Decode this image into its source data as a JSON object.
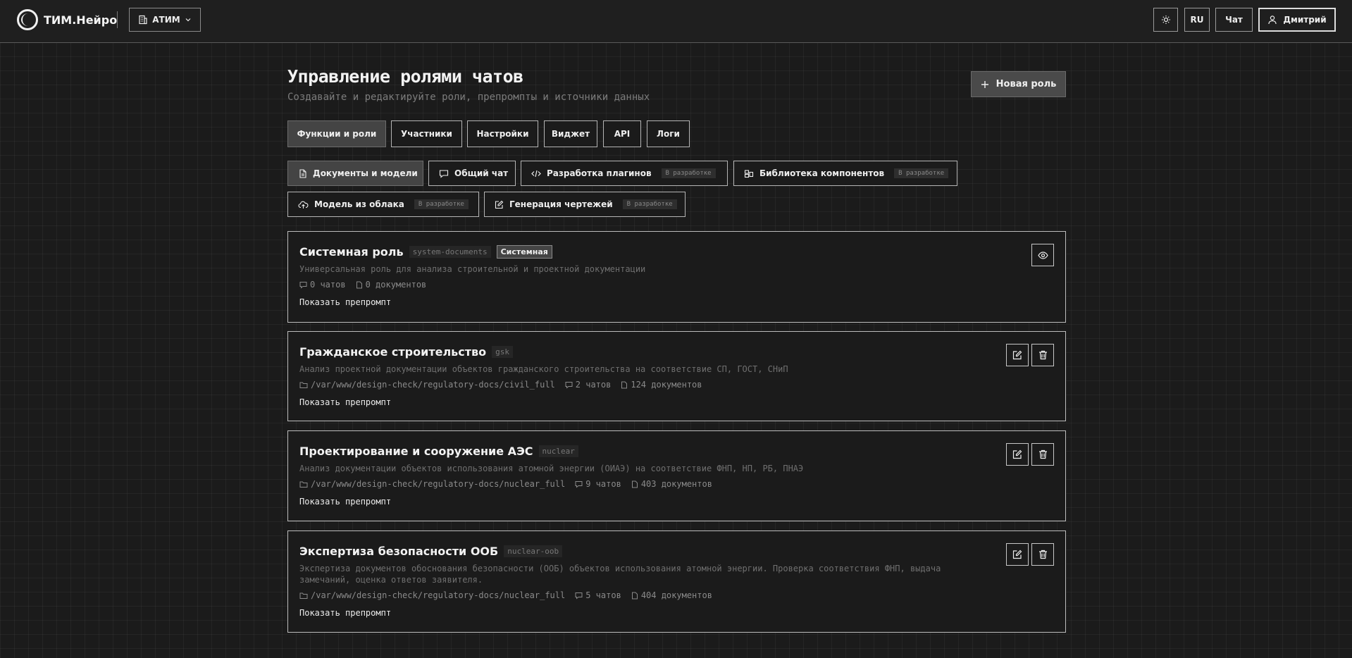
{
  "header": {
    "logo_text": "ТИМ.Нейро",
    "org_label": "АТИМ",
    "lang_label": "RU",
    "chat_label": "Чат",
    "user_label": "Дмитрий"
  },
  "page": {
    "title": "Управление ролями чатов",
    "subtitle": "Создавайте и редактируйте роли, препромпты и источники данных",
    "new_role_label": "Новая роль"
  },
  "tabs": [
    {
      "label": "Функции и роли"
    },
    {
      "label": "Участники"
    },
    {
      "label": "Настройки"
    },
    {
      "label": "Виджет"
    },
    {
      "label": "API"
    },
    {
      "label": "Логи"
    }
  ],
  "subtabs": [
    {
      "label": "Документы и модели",
      "badge": ""
    },
    {
      "label": "Общий чат",
      "badge": ""
    },
    {
      "label": "Разработка плагинов",
      "badge": "В разработке"
    },
    {
      "label": "Библиотека компонентов",
      "badge": "В разработке"
    },
    {
      "label": "Модель из облака",
      "badge": "В разработке"
    },
    {
      "label": "Генерация чертежей",
      "badge": "В разработке"
    }
  ],
  "show_preprompt_label": "Показать препромпт",
  "roles": [
    {
      "name": "Системная роль",
      "slug": "system-documents",
      "badge": "Системная",
      "description": "Универсальная роль для анализа строительной и проектной документации",
      "path": "",
      "chats": "0 чатов",
      "docs": "0 документов"
    },
    {
      "name": "Гражданское строительство",
      "slug": "gsk",
      "badge": "",
      "description": "Анализ проектной документации объектов гражданского строительства на соответствие СП, ГОСТ, СНиП",
      "path": "/var/www/design-check/regulatory-docs/civil_full",
      "chats": "2 чатов",
      "docs": "124 документов"
    },
    {
      "name": "Проектирование и сооружение АЭС",
      "slug": "nuclear",
      "badge": "",
      "description": "Анализ документации объектов использования атомной энергии (ОИАЭ) на соответствие ФНП, НП, РБ, ПНАЭ",
      "path": "/var/www/design-check/regulatory-docs/nuclear_full",
      "chats": "9 чатов",
      "docs": "403 документов"
    },
    {
      "name": "Экспертиза безопасности ООБ",
      "slug": "nuclear-oob",
      "badge": "",
      "description": "Экспертиза документов обоснования безопасности (ООБ) объектов использования атомной энергии. Проверка соответствия ФНП, выдача замечаний, оценка ответов заявителя.",
      "path": "/var/www/design-check/regulatory-docs/nuclear_full",
      "chats": "5 чатов",
      "docs": "404 документов"
    }
  ]
}
